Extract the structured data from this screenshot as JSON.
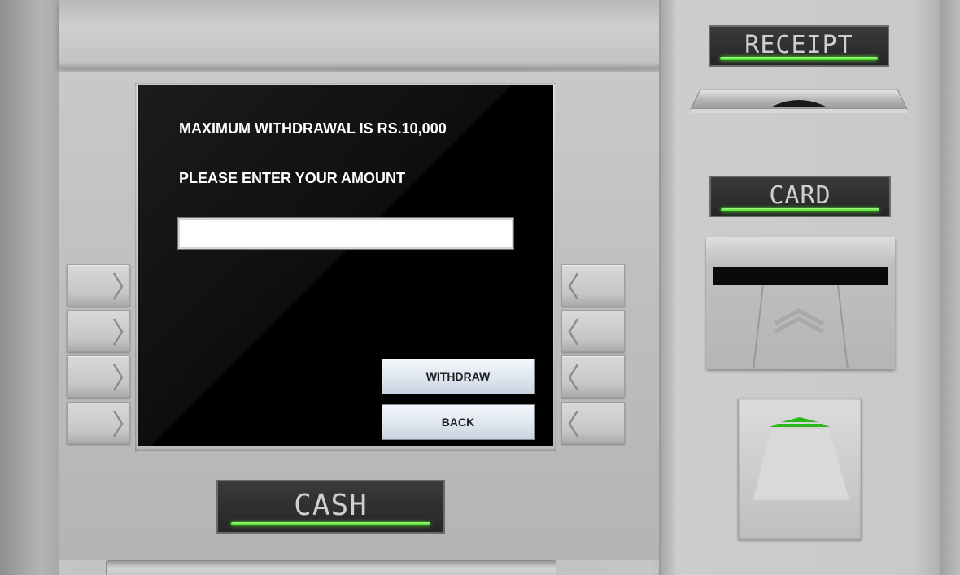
{
  "screen": {
    "max_message": "MAXIMUM WITHDRAWAL IS RS.10,000",
    "prompt": "PLEASE ENTER YOUR AMOUNT",
    "amount_value": "",
    "withdraw_label": "WITHDRAW",
    "back_label": "BACK"
  },
  "labels": {
    "receipt": "RECEIPT",
    "card": "CARD",
    "cash": "CASH"
  },
  "colors": {
    "led_green": "#3ad11f",
    "screen_bg": "#000000"
  }
}
